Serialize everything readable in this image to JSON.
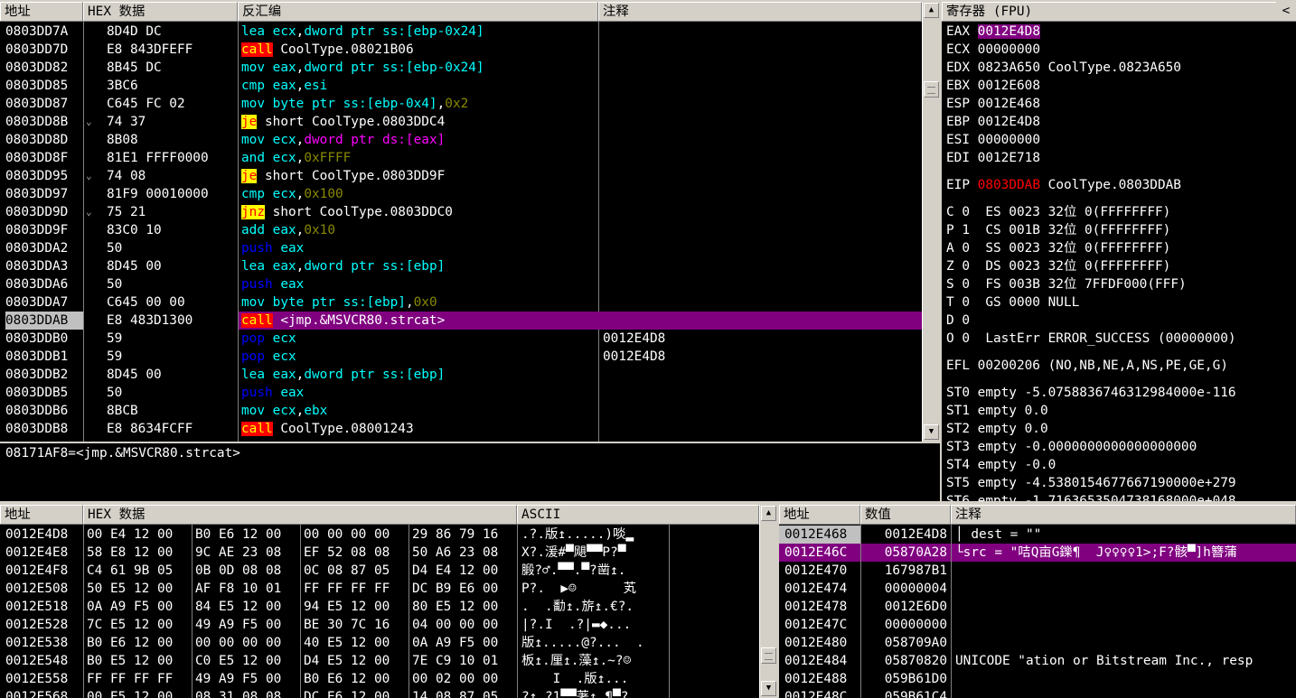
{
  "cpu": {
    "headers": [
      "地址",
      "HEX 数据",
      "反汇编",
      "注释"
    ],
    "rows": [
      {
        "addr": "0803DD7A",
        "arrow": "",
        "hex": "8D4D DC",
        "asm": [
          [
            "lea ",
            "ins"
          ],
          [
            "ecx",
            "reg"
          ],
          [
            ",",
            "sym"
          ],
          [
            "dword ptr ss:[ebp-0x24]",
            "reg"
          ]
        ],
        "comment": ""
      },
      {
        "addr": "0803DD7D",
        "arrow": "",
        "hex": "E8 843DFEFF",
        "asm": [
          [
            "call",
            "call"
          ],
          [
            " CoolType.08021B06",
            "sym"
          ]
        ],
        "comment": ""
      },
      {
        "addr": "0803DD82",
        "arrow": "",
        "hex": "8B45 DC",
        "asm": [
          [
            "mov ",
            "ins"
          ],
          [
            "eax",
            "reg"
          ],
          [
            ",",
            "sym"
          ],
          [
            "dword ptr ss:[ebp-0x24]",
            "reg"
          ]
        ],
        "comment": ""
      },
      {
        "addr": "0803DD85",
        "arrow": "",
        "hex": "3BC6",
        "asm": [
          [
            "cmp ",
            "ins"
          ],
          [
            "eax",
            "reg"
          ],
          [
            ",",
            "sym"
          ],
          [
            "esi",
            "reg"
          ]
        ],
        "comment": ""
      },
      {
        "addr": "0803DD87",
        "arrow": "",
        "hex": "C645 FC 02",
        "asm": [
          [
            "mov ",
            "ins"
          ],
          [
            "byte ptr ss:[ebp-0x4]",
            "reg"
          ],
          [
            ",",
            "sym"
          ],
          [
            "0x2",
            "num"
          ]
        ],
        "comment": ""
      },
      {
        "addr": "0803DD8B",
        "arrow": "⌄",
        "hex": "74 37",
        "asm": [
          [
            "je",
            "jmp"
          ],
          [
            " short CoolType.0803DDC4",
            "sym"
          ]
        ],
        "comment": ""
      },
      {
        "addr": "0803DD8D",
        "arrow": "",
        "hex": "8B08",
        "asm": [
          [
            "mov ",
            "ins"
          ],
          [
            "ecx",
            "reg"
          ],
          [
            ",",
            "sym"
          ],
          [
            "dword ptr ds:[eax]",
            "ptr"
          ]
        ],
        "comment": ""
      },
      {
        "addr": "0803DD8F",
        "arrow": "",
        "hex": "81E1 FFFF0000",
        "asm": [
          [
            "and ",
            "ins"
          ],
          [
            "ecx",
            "reg"
          ],
          [
            ",",
            "sym"
          ],
          [
            "0xFFFF",
            "num"
          ]
        ],
        "comment": ""
      },
      {
        "addr": "0803DD95",
        "arrow": "⌄",
        "hex": "74 08",
        "asm": [
          [
            "je",
            "jmp"
          ],
          [
            " short CoolType.0803DD9F",
            "sym"
          ]
        ],
        "comment": ""
      },
      {
        "addr": "0803DD97",
        "arrow": "",
        "hex": "81F9 00010000",
        "asm": [
          [
            "cmp ",
            "ins"
          ],
          [
            "ecx",
            "reg"
          ],
          [
            ",",
            "sym"
          ],
          [
            "0x100",
            "num"
          ]
        ],
        "comment": ""
      },
      {
        "addr": "0803DD9D",
        "arrow": "⌄",
        "hex": "75 21",
        "asm": [
          [
            "jnz",
            "jmp"
          ],
          [
            " short CoolType.0803DDC0",
            "sym"
          ]
        ],
        "comment": ""
      },
      {
        "addr": "0803DD9F",
        "arrow": "",
        "hex": "83C0 10",
        "asm": [
          [
            "add ",
            "ins"
          ],
          [
            "eax",
            "reg"
          ],
          [
            ",",
            "sym"
          ],
          [
            "0x10",
            "num"
          ]
        ],
        "comment": ""
      },
      {
        "addr": "0803DDA2",
        "arrow": "",
        "hex": "50",
        "asm": [
          [
            "push ",
            "push"
          ],
          [
            "eax",
            "reg"
          ]
        ],
        "comment": ""
      },
      {
        "addr": "0803DDA3",
        "arrow": "",
        "hex": "8D45 00",
        "asm": [
          [
            "lea ",
            "ins"
          ],
          [
            "eax",
            "reg"
          ],
          [
            ",",
            "sym"
          ],
          [
            "dword ptr ss:[ebp]",
            "reg"
          ]
        ],
        "comment": ""
      },
      {
        "addr": "0803DDA6",
        "arrow": "",
        "hex": "50",
        "asm": [
          [
            "push ",
            "push"
          ],
          [
            "eax",
            "reg"
          ]
        ],
        "comment": ""
      },
      {
        "addr": "0803DDA7",
        "arrow": "",
        "hex": "C645 00 00",
        "asm": [
          [
            "mov ",
            "ins"
          ],
          [
            "byte ptr ss:[ebp]",
            "reg"
          ],
          [
            ",",
            "sym"
          ],
          [
            "0x0",
            "num"
          ]
        ],
        "comment": ""
      },
      {
        "addr": "0803DDAB",
        "arrow": "",
        "hex": "E8 483D1300",
        "asm": [
          [
            "call",
            "call"
          ],
          [
            " <jmp.&MSVCR80.strcat>",
            "sym"
          ]
        ],
        "comment": "",
        "selected": true
      },
      {
        "addr": "0803DDB0",
        "arrow": "",
        "hex": "59",
        "asm": [
          [
            "pop ",
            "push"
          ],
          [
            "ecx",
            "reg"
          ]
        ],
        "comment": "0012E4D8"
      },
      {
        "addr": "0803DDB1",
        "arrow": "",
        "hex": "59",
        "asm": [
          [
            "pop ",
            "push"
          ],
          [
            "ecx",
            "reg"
          ]
        ],
        "comment": "0012E4D8"
      },
      {
        "addr": "0803DDB2",
        "arrow": "",
        "hex": "8D45 00",
        "asm": [
          [
            "lea ",
            "ins"
          ],
          [
            "eax",
            "reg"
          ],
          [
            ",",
            "sym"
          ],
          [
            "dword ptr ss:[ebp]",
            "reg"
          ]
        ],
        "comment": ""
      },
      {
        "addr": "0803DDB5",
        "arrow": "",
        "hex": "50",
        "asm": [
          [
            "push ",
            "push"
          ],
          [
            "eax",
            "reg"
          ]
        ],
        "comment": ""
      },
      {
        "addr": "0803DDB6",
        "arrow": "",
        "hex": "8BCB",
        "asm": [
          [
            "mov ",
            "ins"
          ],
          [
            "ecx",
            "reg"
          ],
          [
            ",",
            "sym"
          ],
          [
            "ebx",
            "reg"
          ]
        ],
        "comment": ""
      },
      {
        "addr": "0803DDB8",
        "arrow": "",
        "hex": "E8 8634FCFF",
        "asm": [
          [
            "call",
            "call"
          ],
          [
            " CoolType.08001243",
            "sym"
          ]
        ],
        "comment": ""
      }
    ],
    "info": "08171AF8=<jmp.&MSVCR80.strcat>"
  },
  "registers": {
    "title": "寄存器 (FPU)",
    "collapse": "<",
    "gp": [
      [
        "EAX",
        "0012E4D8",
        "",
        true
      ],
      [
        "ECX",
        "00000000",
        "",
        false
      ],
      [
        "EDX",
        "0823A650",
        "CoolType.0823A650",
        false
      ],
      [
        "EBX",
        "0012E608",
        "",
        false
      ],
      [
        "ESP",
        "0012E468",
        "",
        false
      ],
      [
        "EBP",
        "0012E4D8",
        "",
        false
      ],
      [
        "ESI",
        "00000000",
        "",
        false
      ],
      [
        "EDI",
        "0012E718",
        "",
        false
      ]
    ],
    "eip": {
      "name": "EIP",
      "value": "0803DDAB",
      "note": "CoolType.0803DDAB"
    },
    "flags": [
      "C 0  ES 0023 32位 0(FFFFFFFF)",
      "P 1  CS 001B 32位 0(FFFFFFFF)",
      "A 0  SS 0023 32位 0(FFFFFFFF)",
      "Z 0  DS 0023 32位 0(FFFFFFFF)",
      "S 0  FS 003B 32位 7FFDF000(FFF)",
      "T 0  GS 0000 NULL",
      "D 0",
      "O 0  LastErr ERROR_SUCCESS (00000000)"
    ],
    "efl": "EFL 00200206 (NO,NB,NE,A,NS,PE,GE,G)",
    "fpu": [
      "ST0 empty -5.0758836746312984000e-116",
      "ST1 empty 0.0",
      "ST2 empty 0.0",
      "ST3 empty -0.0000000000000000000",
      "ST4 empty -0.0",
      "ST5 empty -4.5380154677667190000e+279",
      "ST6 empty -1.7163653504738168000e+048"
    ]
  },
  "dump": {
    "headers": [
      "地址",
      "HEX 数据",
      "ASCII"
    ],
    "rows": [
      [
        "0012E4D8",
        "00 E4 12 00",
        "B0 E6 12 00",
        "00 00 00 00",
        "29 86 79 16",
        ".?.版↥.....)啖▂"
      ],
      [
        "0012E4E8",
        "58 E8 12 00",
        "9C AE 23 08",
        "EF 52 08 08",
        "50 A6 23 08",
        "X?.湲#▀飓▀▀P?▀"
      ],
      [
        "0012E4F8",
        "C4 61 9B 05",
        "0B 0D 08 08",
        "0C 08 87 05",
        "D4 E4 12 00",
        "腶?♂.▀▀.▀?凿↥."
      ],
      [
        "0012E508",
        "50 E5 12 00",
        "AF F8 10 01",
        "FF FF FF FF",
        "DC B9 E6 00",
        "P?.  ▶☺      芄"
      ],
      [
        "0012E518",
        "0A A9 F5 00",
        "84 E5 12 00",
        "94 E5 12 00",
        "80 E5 12 00",
        ".  .勫↥.旂↥.€?."
      ],
      [
        "0012E528",
        "7C E5 12 00",
        "49 A9 F5 00",
        "BE 30 7C 16",
        "04 00 00 00",
        "|?.I  .?|▬◆..."
      ],
      [
        "0012E538",
        "B0 E6 12 00",
        "00 00 00 00",
        "40 E5 12 00",
        "0A A9 F5 00",
        "版↥.....@?...  ."
      ],
      [
        "0012E548",
        "B0 E5 12 00",
        "C0 E5 12 00",
        "D4 E5 12 00",
        "7E C9 10 01",
        "板↥.厘↥.藻↥.~?☺"
      ],
      [
        "0012E558",
        "FF FF FF FF",
        "49 A9 F5 00",
        "B0 E6 12 00",
        "00 02 00 00",
        "    I  .版↥..."
      ],
      [
        "0012E568",
        "00 E5 12 00",
        "08 31 08 08",
        "DC E6 12 00",
        "14 08 87 05",
        "?↥.?1▀▀荖↥.¶▀?"
      ]
    ]
  },
  "stack": {
    "headers": [
      "地址",
      "数值",
      "注释"
    ],
    "rows": [
      [
        "0012E468",
        "0012E4D8",
        "│ dest = \"\"",
        true,
        false
      ],
      [
        "0012E46C",
        "05870A28",
        "└src = \"咭Q亩G鑠¶  J♀♀♀♀1>;F?骸▀]h簪蒲",
        false,
        true
      ],
      [
        "0012E470",
        "167987B1",
        "",
        false,
        false
      ],
      [
        "0012E474",
        "00000004",
        "",
        false,
        false
      ],
      [
        "0012E478",
        "0012E6D0",
        "",
        false,
        false
      ],
      [
        "0012E47C",
        "00000000",
        "",
        false,
        false
      ],
      [
        "0012E480",
        "058709A0",
        "",
        false,
        false
      ],
      [
        "0012E484",
        "05870820",
        "UNICODE \"ation or Bitstream Inc., resp",
        false,
        false
      ],
      [
        "0012E488",
        "059B61D0",
        "",
        false,
        false
      ],
      [
        "0012E48C",
        "059B61C4",
        "",
        false,
        false
      ]
    ]
  }
}
